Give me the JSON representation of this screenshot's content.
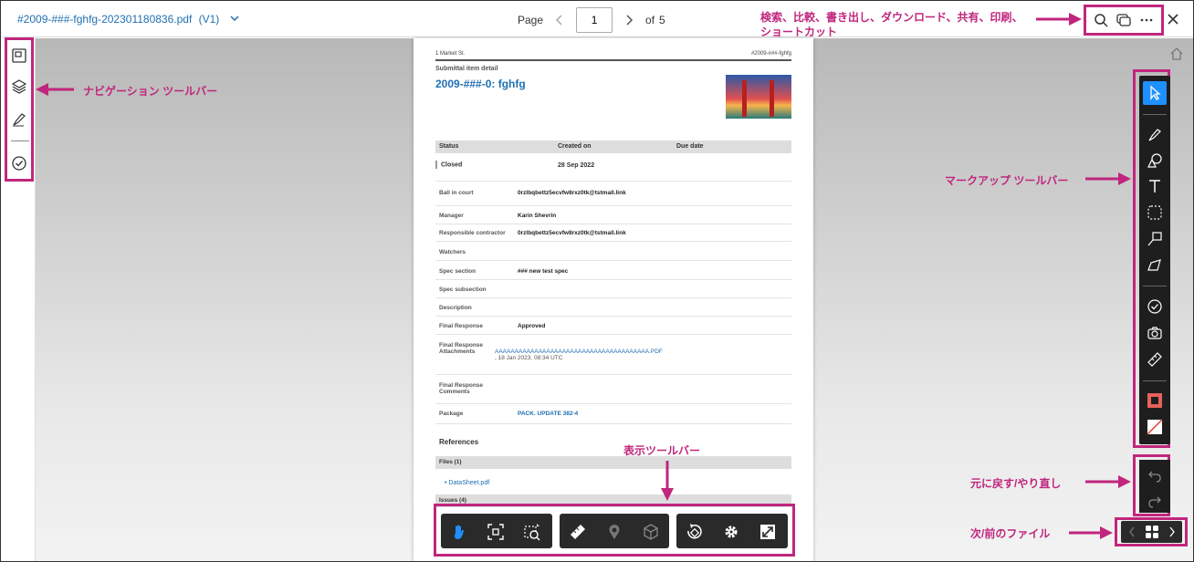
{
  "header": {
    "file_name": "#2009-###-fghfg-202301180836.pdf",
    "version": "(V1)",
    "page_label": "Page",
    "page_value": "1",
    "of_label": "of",
    "total_pages": "5"
  },
  "top_right_icons": [
    "search-icon",
    "compare-icon",
    "more-icon",
    "close-icon"
  ],
  "nav_toolbar_icons": [
    "thumbnails-icon",
    "layers-icon",
    "markup-list-icon",
    "issues-check-icon"
  ],
  "markup_toolbar_icons": [
    "select-arrow-icon",
    "pen-icon",
    "shapes-icon",
    "text-icon",
    "area-select-icon",
    "callout-icon",
    "polyline-icon",
    "check-circle-icon",
    "camera-icon",
    "ruler-icon",
    "stroke-color-icon",
    "fill-color-icon"
  ],
  "document": {
    "header_left": "1 Market St.",
    "header_right": "#2009-###-fghfg",
    "subtitle": "Submittal item detail",
    "title": "2009-###-0: fghfg",
    "table_headers": {
      "status": "Status",
      "created": "Created on",
      "due": "Due date"
    },
    "status_value": "Closed",
    "created_value": "28 Sep 2022",
    "fields": [
      {
        "label": "Ball in court",
        "value": "0rzlbqbettz5ecvfw8rxz0tk@tstmall.link"
      },
      {
        "label": "Manager",
        "value": "Karin Shevrin"
      },
      {
        "label": "Responsible contractor",
        "value": "0rzlbqbettz5ecvfw8rxz0tk@tstmall.link"
      },
      {
        "label": "Watchers",
        "value": ""
      },
      {
        "label": "Spec section",
        "value": "### new test spec"
      },
      {
        "label": "Spec subsection",
        "value": ""
      },
      {
        "label": "Description",
        "value": ""
      },
      {
        "label": "Final Response",
        "value": "Approved"
      }
    ],
    "attachments_label": "Final Response Attachments",
    "attachments_link": "AAAAAAAAAAAAAAAAAAAAAAAAAAAAAAAAAAAAAAA.PDF",
    "attachments_date": ", 18 Jan 2023, 08:34 UTC",
    "comments_label": "Final Response Comments",
    "package_label": "Package",
    "package_value": "PACK. UPDATE 382-4",
    "references_title": "References",
    "files_header": "Files (1)",
    "file_link": "DataSheet.pdf",
    "issues_header": "Issues (4)"
  },
  "annotations": {
    "top_right": "検索、比較、書き出し、ダウンロード、共有、印刷、",
    "top_right_2": "ショートカット",
    "nav": "ナビゲーション ツールバー",
    "markup": "マークアップ ツールバー",
    "view": "表示ツールバー",
    "undo": "元に戻す/やり直し",
    "file_nav": "次/前のファイル"
  },
  "colors": {
    "accent": "#c0267d",
    "link": "#1f6fb2",
    "toolbar": "#1e1e1e",
    "selected": "#1e90ff"
  }
}
